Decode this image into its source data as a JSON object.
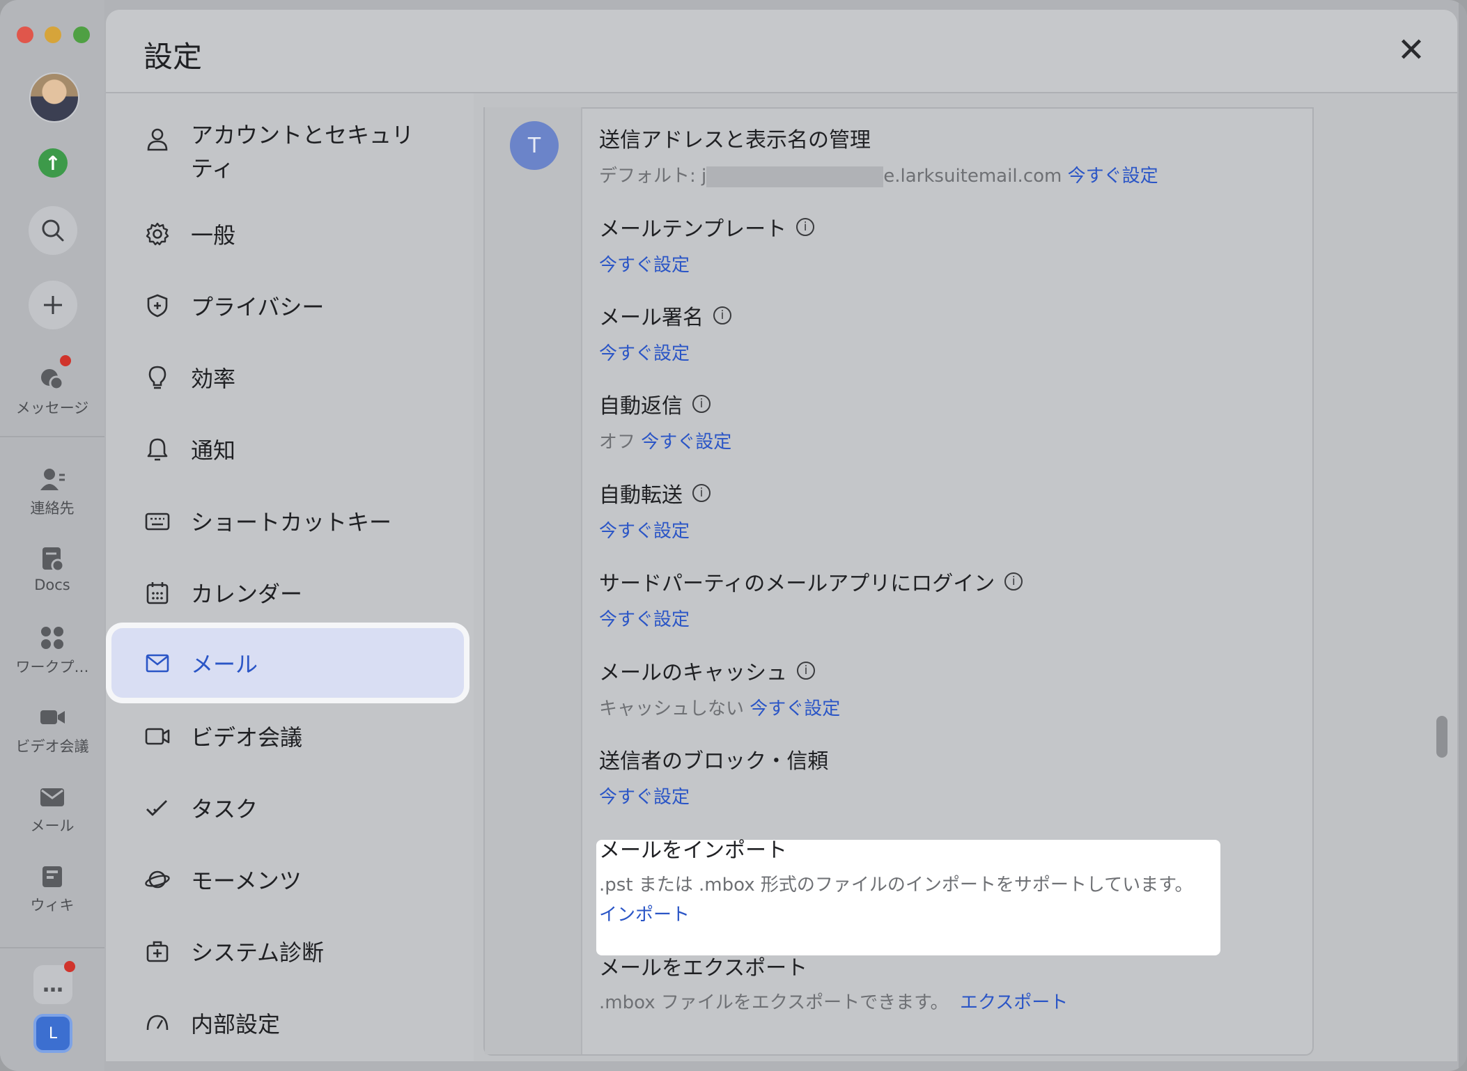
{
  "app": {
    "rail": {
      "items": [
        {
          "label": "メッセージ",
          "icon": "chat-bubble-icon"
        },
        {
          "label": "連絡先",
          "icon": "contacts-icon"
        },
        {
          "label": "Docs",
          "icon": "docs-icon"
        },
        {
          "label": "ワークプ…",
          "icon": "workplace-grid-icon"
        },
        {
          "label": "ビデオ会議",
          "icon": "video-camera-icon"
        },
        {
          "label": "メール",
          "icon": "mail-icon"
        },
        {
          "label": "ウィキ",
          "icon": "wiki-icon"
        }
      ],
      "workspace_initial": "L",
      "more_label": "…"
    }
  },
  "dialog": {
    "title": "設定",
    "close_glyph": "✕"
  },
  "nav": {
    "items": [
      {
        "label": "アカウントとセキュリティ",
        "icon": "person-icon"
      },
      {
        "label": "一般",
        "icon": "gear-icon"
      },
      {
        "label": "プライバシー",
        "icon": "shield-icon"
      },
      {
        "label": "効率",
        "icon": "lightbulb-icon"
      },
      {
        "label": "通知",
        "icon": "bell-icon"
      },
      {
        "label": "ショートカットキー",
        "icon": "keyboard-icon"
      },
      {
        "label": "カレンダー",
        "icon": "calendar-icon"
      },
      {
        "label": "メール",
        "icon": "mail-icon",
        "selected": true
      },
      {
        "label": "ビデオ会議",
        "icon": "video-camera-icon"
      },
      {
        "label": "タスク",
        "icon": "task-check-icon"
      },
      {
        "label": "モーメンツ",
        "icon": "planet-icon"
      },
      {
        "label": "システム診断",
        "icon": "medkit-icon"
      },
      {
        "label": "内部設定",
        "icon": "dial-icon"
      }
    ]
  },
  "mail_settings": {
    "account_avatar": "T",
    "sender_address": {
      "title": "送信アドレスと表示名の管理",
      "default_prefix": "デフォルト: j",
      "default_suffix": "e.larksuitemail.com",
      "link": "今すぐ設定"
    },
    "template": {
      "title": "メールテンプレート",
      "link": "今すぐ設定"
    },
    "signature": {
      "title": "メール署名",
      "link": "今すぐ設定"
    },
    "auto_reply": {
      "title": "自動返信",
      "status": "オフ",
      "link": "今すぐ設定"
    },
    "auto_forward": {
      "title": "自動転送",
      "link": "今すぐ設定"
    },
    "third_party": {
      "title": "サードパーティのメールアプリにログイン",
      "link": "今すぐ設定"
    },
    "cache": {
      "title": "メールのキャッシュ",
      "status": "キャッシュしない",
      "link": "今すぐ設定"
    },
    "block_trust": {
      "title": "送信者のブロック・信頼",
      "link": "今すぐ設定"
    },
    "import": {
      "title": "メールをインポート",
      "desc": ".pst または .mbox 形式のファイルのインポートをサポートしています。",
      "link": "インポート"
    },
    "export": {
      "title": "メールをエクスポート",
      "desc": ".mbox ファイルをエクスポートできます。",
      "link": "エクスポート"
    },
    "info_glyph": "i"
  }
}
